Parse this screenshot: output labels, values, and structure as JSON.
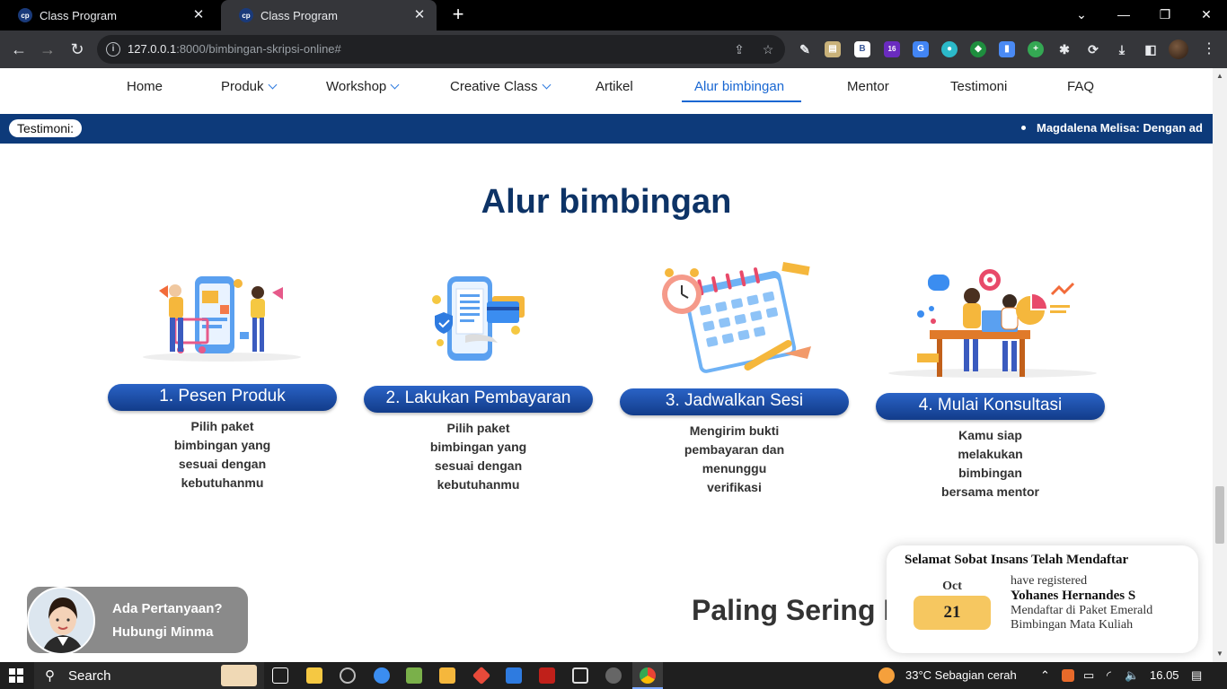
{
  "browser": {
    "tabs": [
      {
        "title": "Class Program",
        "active": false
      },
      {
        "title": "Class Program",
        "active": true
      }
    ],
    "favicon_text": "cp",
    "url_host": "127.0.0.1",
    "url_rest": ":8000/bimbingan-skripsi-online#",
    "extension_badge": "16"
  },
  "nav": {
    "items": [
      {
        "label": "Home",
        "dropdown": false
      },
      {
        "label": "Produk",
        "dropdown": true
      },
      {
        "label": "Workshop",
        "dropdown": true
      },
      {
        "label": "Creative Class",
        "dropdown": true
      },
      {
        "label": "Artikel",
        "dropdown": false
      },
      {
        "label": "Alur bimbingan",
        "dropdown": false,
        "active": true
      },
      {
        "label": "Mentor",
        "dropdown": false
      },
      {
        "label": "Testimoni",
        "dropdown": false
      },
      {
        "label": "FAQ",
        "dropdown": false
      }
    ]
  },
  "ticker": {
    "label": "Testimoni:",
    "message": "Magdalena Melisa: Dengan ad"
  },
  "section": {
    "title": "Alur bimbingan",
    "steps": [
      {
        "title": "1. Pesen Produk",
        "desc": [
          "Pilih paket",
          "bimbingan yang",
          "sesuai dengan",
          "kebutuhanmu"
        ]
      },
      {
        "title": "2. Lakukan Pembayaran",
        "desc": [
          "Pilih paket",
          "bimbingan yang",
          "sesuai dengan",
          "kebutuhanmu"
        ]
      },
      {
        "title": "3. Jadwalkan Sesi",
        "desc": [
          "Mengirim bukti",
          "pembayaran dan",
          "menunggu",
          "verifikasi"
        ]
      },
      {
        "title": "4. Mulai Konsultasi",
        "desc": [
          "Kamu siap",
          "melakukan",
          "bimbingan",
          "bersama mentor"
        ]
      }
    ]
  },
  "faq": {
    "title_partial": "Paling Sering D"
  },
  "chat": {
    "line1": "Ada Pertanyaan?",
    "line2": "Hubungi Minma"
  },
  "toast": {
    "heading": "Selamat Sobat Insans Telah Mendaftar",
    "month": "Oct",
    "day": "21",
    "line1": "have registered",
    "name": "Yohanes Hernandes S",
    "line3": "Mendaftar di Paket Emerald",
    "line4": "Bimbingan Mata Kuliah"
  },
  "taskbar": {
    "search": "Search",
    "weather": "33°C  Sebagian cerah",
    "time": "16.05"
  },
  "colors": {
    "brand_navy": "#0d3366",
    "ticker_bg": "#0d3a7a",
    "active_link": "#1967d2",
    "date_badge": "#f6c760"
  }
}
